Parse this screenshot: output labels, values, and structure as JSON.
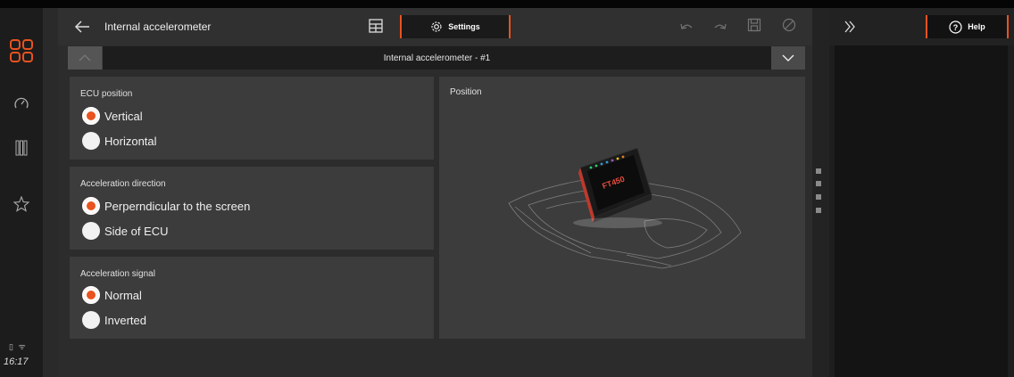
{
  "header": {
    "title": "Internal accelerometer",
    "settings_tab": "Settings"
  },
  "selector": {
    "value": "Internal accelerometer - #1"
  },
  "panels": {
    "ecu_position": {
      "title": "ECU position",
      "options": [
        "Vertical",
        "Horizontal"
      ],
      "selected": "Vertical"
    },
    "accel_direction": {
      "title": "Acceleration direction",
      "options": [
        "Perperndicular to the screen",
        "Side of ECU"
      ],
      "selected": "Perperndicular to the screen"
    },
    "accel_signal": {
      "title": "Acceleration signal",
      "options": [
        "Normal",
        "Inverted"
      ],
      "selected": "Normal"
    },
    "position": {
      "title": "Position"
    }
  },
  "side_panel": {
    "help_tab": "Help"
  },
  "status": {
    "clock": "16:17"
  },
  "colors": {
    "accent": "#e8531f",
    "background": "#2a2a2a",
    "panel": "#3c3c3c"
  },
  "icons": [
    "dashboard-grid-icon",
    "gauge-icon",
    "columns-icon",
    "star-icon",
    "back-arrow-icon",
    "table-icon",
    "gear-icon",
    "undo-icon",
    "redo-icon",
    "save-icon",
    "disabled-icon",
    "chevron-up-icon",
    "chevron-down-icon",
    "double-chevron-icon",
    "help-icon",
    "battery-icon",
    "wifi-icon"
  ]
}
